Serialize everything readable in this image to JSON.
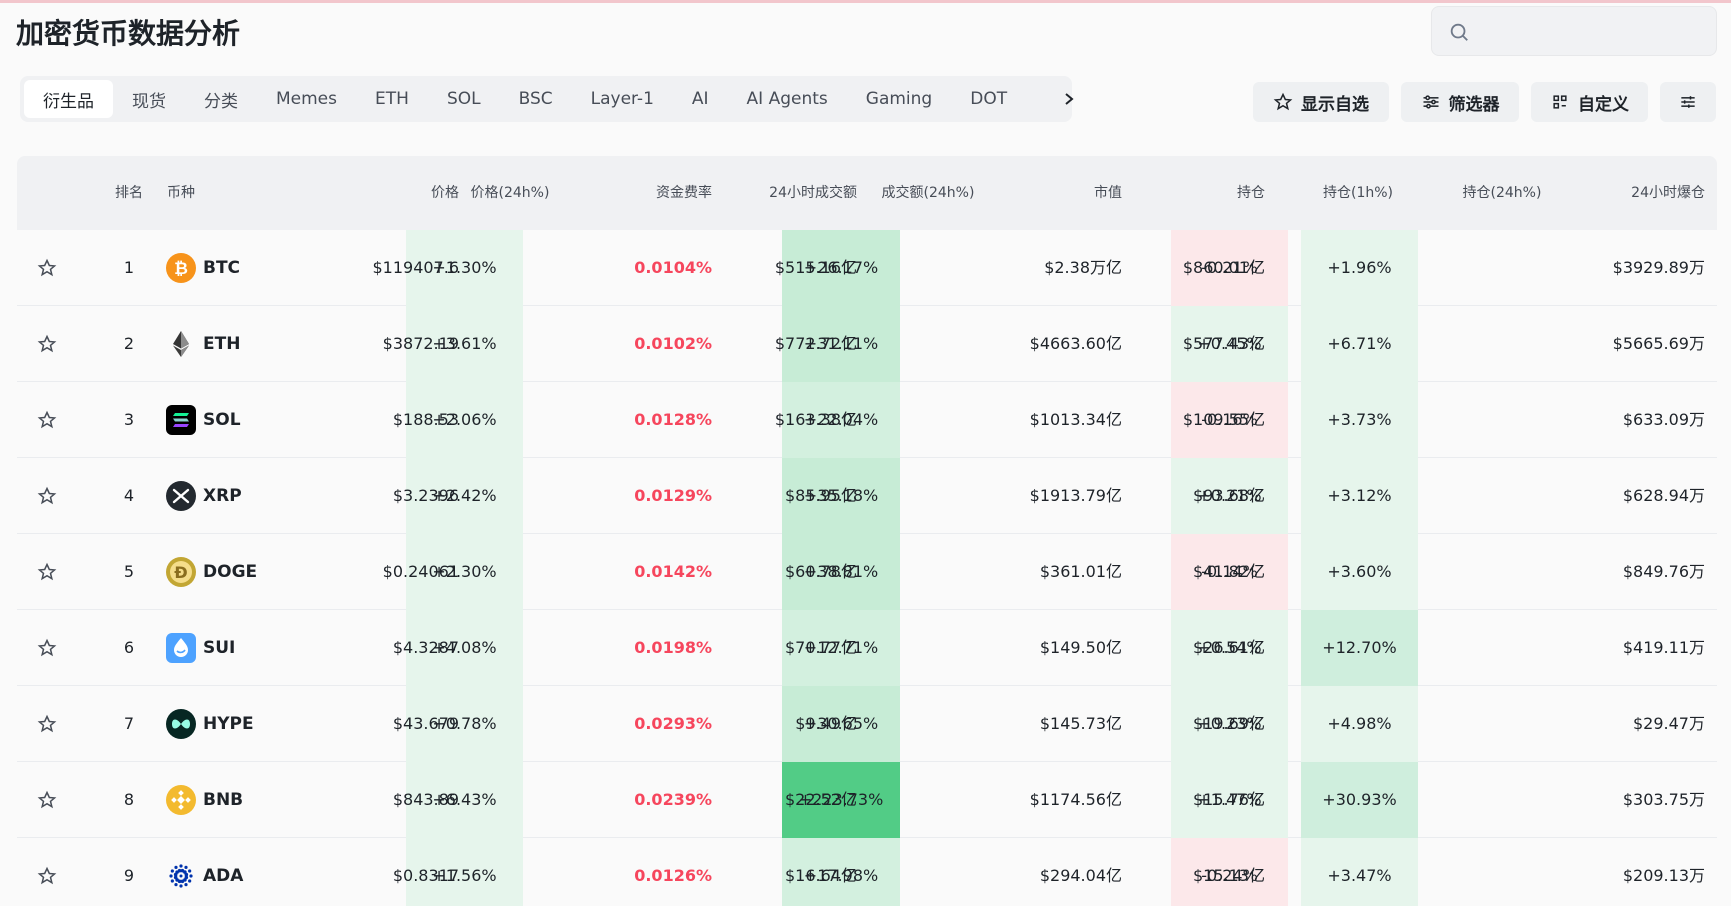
{
  "page": {
    "title": "加密货币数据分析"
  },
  "search": {
    "placeholder": ""
  },
  "tabs": [
    {
      "label": "衍生品",
      "active": true
    },
    {
      "label": "现货",
      "active": false
    },
    {
      "label": "分类",
      "active": false
    },
    {
      "label": "Memes",
      "active": false
    },
    {
      "label": "ETH",
      "active": false
    },
    {
      "label": "SOL",
      "active": false
    },
    {
      "label": "BSC",
      "active": false
    },
    {
      "label": "Layer-1",
      "active": false
    },
    {
      "label": "AI",
      "active": false
    },
    {
      "label": "AI Agents",
      "active": false
    },
    {
      "label": "Gaming",
      "active": false
    },
    {
      "label": "DOT",
      "active": false
    }
  ],
  "actions": {
    "watchlist": "显示自选",
    "filter": "筛选器",
    "customize": "自定义"
  },
  "table": {
    "headers": {
      "rank": "排名",
      "coin": "币种",
      "price": "价格",
      "change24h": "价格(24h%)",
      "funding": "资金费率",
      "volume24h": "24小时成交额",
      "volchange": "成交额(24h%)",
      "mcap": "市值",
      "oi": "持仓",
      "oi1h": "持仓(1h%)",
      "oi24h": "持仓(24h%)",
      "liq24h": "24小时爆仓"
    },
    "rows": [
      {
        "rank": "1",
        "coin": "BTC",
        "icon": "bitcoin-icon",
        "price": "$119407.6",
        "change24h": "+1.30%",
        "funding": "0.0104%",
        "volume24h": "$515.16亿",
        "volchange": "+26.17%",
        "volchange_level": 0.12,
        "mcap": "$2.38万亿",
        "oi": "$860.01亿",
        "oi1h": "-0.21%",
        "oi24h": "+1.96%",
        "liq24h": "$3929.89万"
      },
      {
        "rank": "2",
        "coin": "ETH",
        "icon": "ethereum-icon",
        "price": "$3872.19",
        "change24h": "+3.61%",
        "funding": "0.0102%",
        "volume24h": "$772.72亿",
        "volchange": "+31.11%",
        "volchange_level": 0.14,
        "mcap": "$4663.60亿",
        "oi": "$577.43亿",
        "oi1h": "+0.45%",
        "oi24h": "+6.71%",
        "liq24h": "$5665.69万"
      },
      {
        "rank": "3",
        "coin": "SOL",
        "icon": "solana-icon",
        "price": "$188.53",
        "change24h": "+2.06%",
        "funding": "0.0128%",
        "volume24h": "$163.38亿",
        "volchange": "+22.04%",
        "volchange_level": 0.1,
        "mcap": "$1013.34亿",
        "oi": "$109.55亿",
        "oi1h": "-0.16%",
        "oi24h": "+3.73%",
        "liq24h": "$633.09万"
      },
      {
        "rank": "4",
        "coin": "XRP",
        "icon": "xrp-icon",
        "price": "$3.2396",
        "change24h": "+2.42%",
        "funding": "0.0129%",
        "volume24h": "$85.95亿",
        "volchange": "+35.18%",
        "volchange_level": 0.16,
        "mcap": "$1913.79亿",
        "oi": "$93.68亿",
        "oi1h": "+0.21%",
        "oi24h": "+3.12%",
        "liq24h": "$628.94万"
      },
      {
        "rank": "5",
        "coin": "DOGE",
        "icon": "dogecoin-icon",
        "price": "$0.24061",
        "change24h": "+2.30%",
        "funding": "0.0142%",
        "volume24h": "$60.78亿",
        "volchange": "+38.81%",
        "volchange_level": 0.17,
        "mcap": "$361.01亿",
        "oi": "$41.82亿",
        "oi1h": "-0.14%",
        "oi24h": "+3.60%",
        "liq24h": "$849.76万"
      },
      {
        "rank": "6",
        "coin": "SUI",
        "icon": "sui-icon",
        "price": "$4.3287",
        "change24h": "+4.08%",
        "funding": "0.0198%",
        "volume24h": "$70.77亿",
        "volchange": "+12.71%",
        "volchange_level": 0.06,
        "mcap": "$149.50亿",
        "oi": "$26.61亿",
        "oi1h": "+0.54%",
        "oi24h": "+12.70%",
        "liq24h": "$419.11万"
      },
      {
        "rank": "7",
        "coin": "HYPE",
        "icon": "hyperliquid-icon",
        "price": "$43.679",
        "change24h": "+0.78%",
        "funding": "0.0293%",
        "volume24h": "$9.49亿",
        "volchange": "+30.65%",
        "volchange_level": 0.14,
        "mcap": "$145.73亿",
        "oi": "$19.69亿",
        "oi1h": "+0.23%",
        "oi24h": "+4.98%",
        "liq24h": "$29.47万"
      },
      {
        "rank": "8",
        "coin": "BNB",
        "icon": "bnb-icon",
        "price": "$843.89",
        "change24h": "+6.43%",
        "funding": "0.0239%",
        "volume24h": "$22.52亿",
        "volchange": "+223.73%",
        "volchange_level": 1.0,
        "mcap": "$1174.56亿",
        "oi": "$15.76亿",
        "oi1h": "+1.47%",
        "oi24h": "+30.93%",
        "liq24h": "$303.75万"
      },
      {
        "rank": "9",
        "coin": "ADA",
        "icon": "cardano-icon",
        "price": "$0.8317",
        "change24h": "+1.56%",
        "funding": "0.0126%",
        "volume24h": "$16.64亿",
        "volchange": "+17.98%",
        "volchange_level": 0.08,
        "mcap": "$294.04亿",
        "oi": "$15.13亿",
        "oi1h": "-0.24%",
        "oi24h": "+3.47%",
        "liq24h": "$209.13万"
      }
    ]
  },
  "colors": {
    "up_light": "#e6f5ec",
    "up_mid": "#d3f0df",
    "up_strong": "#52cc86",
    "down_light": "#fce8ea",
    "funding_text": "#f6465d"
  }
}
